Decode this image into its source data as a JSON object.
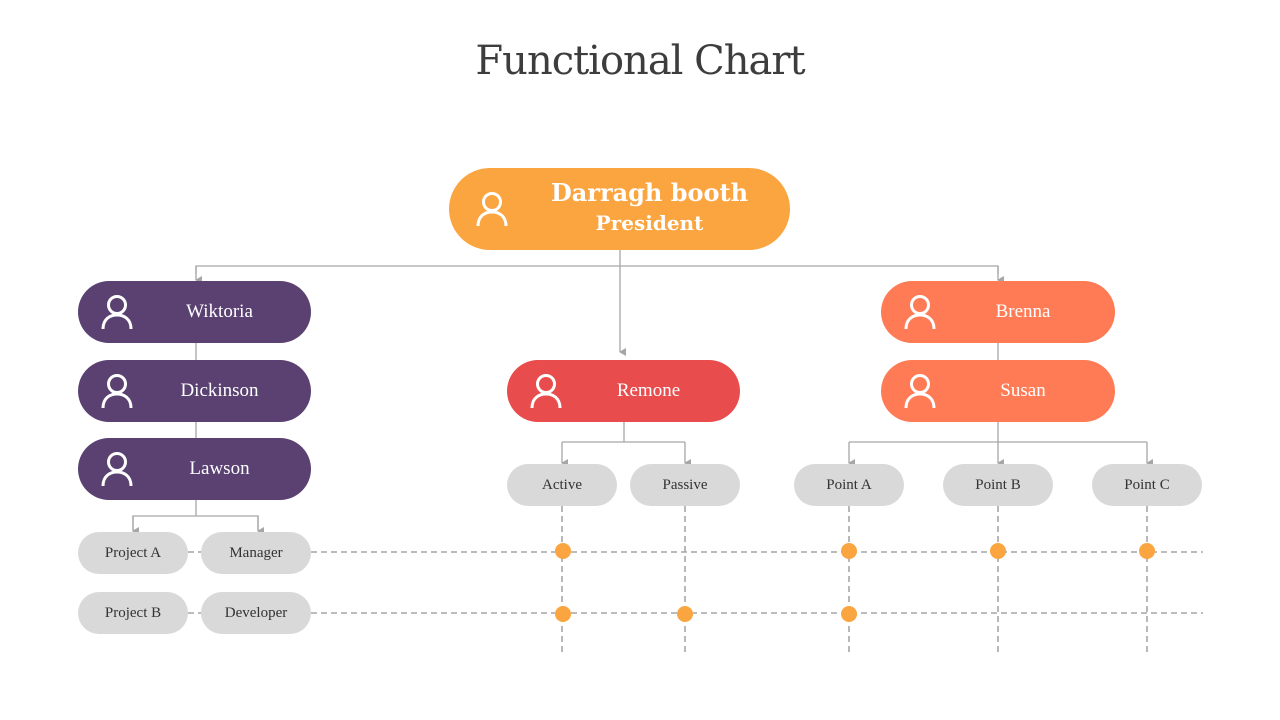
{
  "title": "Functional Chart",
  "colors": {
    "president": "#fba541",
    "left_branch": "#5a4172",
    "center_branch": "#e84c4d",
    "right_branch": "#ff7b55",
    "pill": "#d9d9d9",
    "dot": "#fba541",
    "line": "#a6a6a6"
  },
  "president": {
    "name": "Darragh booth",
    "role": "President",
    "icon": "user-icon"
  },
  "left_branch": [
    {
      "name": "Wiktoria",
      "icon": "user-icon"
    },
    {
      "name": "Dickinson",
      "icon": "user-icon"
    },
    {
      "name": "Lawson",
      "icon": "user-icon"
    }
  ],
  "center_branch": {
    "name": "Remone",
    "icon": "user-icon"
  },
  "right_branch": [
    {
      "name": "Brenna",
      "icon": "user-icon"
    },
    {
      "name": "Susan",
      "icon": "user-icon"
    }
  ],
  "rows": [
    {
      "project": "Project A",
      "role": "Manager"
    },
    {
      "project": "Project B",
      "role": "Developer"
    }
  ],
  "columns": [
    "Active",
    "Passive",
    "Point A",
    "Point B",
    "Point C"
  ],
  "matrix": [
    [
      true,
      false,
      true,
      true,
      true
    ],
    [
      true,
      true,
      true,
      false,
      false
    ]
  ]
}
